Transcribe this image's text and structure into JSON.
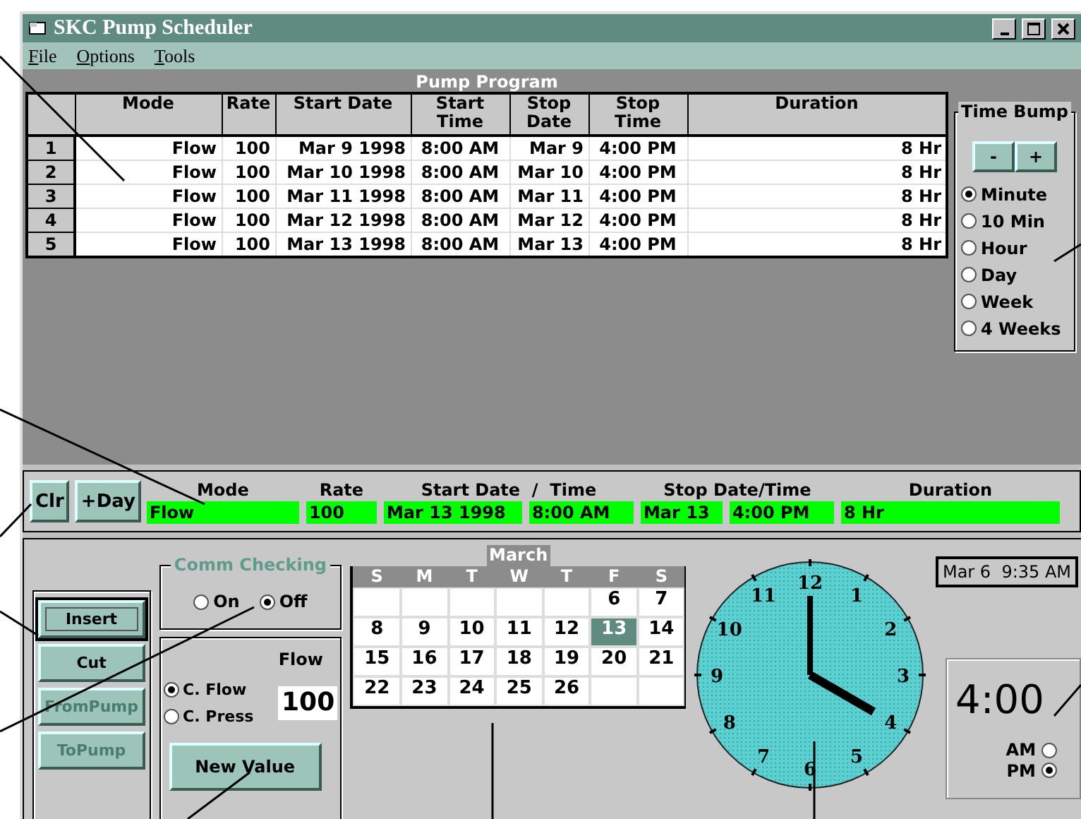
{
  "window": {
    "title": "SKC Pump Scheduler"
  },
  "menu": [
    "File",
    "Options",
    "Tools"
  ],
  "pump_program": {
    "title": "Pump Program",
    "columns": [
      "",
      "Mode",
      "Rate",
      "Start Date",
      "Start Time",
      "Stop Date",
      "Stop Time",
      "Duration"
    ],
    "rows": [
      {
        "cells": [
          "1",
          "Flow",
          "100",
          "Mar 9 1998",
          "8:00 AM",
          "Mar 9",
          "4:00 PM",
          "8 Hr"
        ]
      },
      {
        "cells": [
          "2",
          "Flow",
          "100",
          "Mar 10 1998",
          "8:00 AM",
          "Mar 10",
          "4:00 PM",
          "8 Hr"
        ]
      },
      {
        "cells": [
          "3",
          "Flow",
          "100",
          "Mar 11 1998",
          "8:00 AM",
          "Mar 11",
          "4:00 PM",
          "8 Hr"
        ]
      },
      {
        "cells": [
          "4",
          "Flow",
          "100",
          "Mar 12 1998",
          "8:00 AM",
          "Mar 12",
          "4:00 PM",
          "8 Hr"
        ]
      },
      {
        "cells": [
          "5",
          "Flow",
          "100",
          "Mar 13 1998",
          "8:00 AM",
          "Mar 13",
          "4:00 PM",
          "8 Hr"
        ]
      }
    ]
  },
  "time_bump": {
    "title": "Time Bump",
    "buttons": [
      "-",
      "+"
    ],
    "options": [
      {
        "label": "Minute",
        "selected": true
      },
      {
        "label": "10 Min",
        "selected": false
      },
      {
        "label": "Hour",
        "selected": false
      },
      {
        "label": "Day",
        "selected": false
      },
      {
        "label": "Week",
        "selected": false
      },
      {
        "label": "4 Weeks",
        "selected": false
      }
    ]
  },
  "current_entry": {
    "buttons": [
      "Clr",
      "+Day"
    ],
    "headings": [
      "Mode",
      "Rate",
      "Start Date  /  Time",
      "Stop Date/Time",
      "Duration"
    ],
    "values": [
      "Flow",
      "100",
      "Mar 13 1998",
      "8:00 AM",
      "Mar 13",
      "4:00 PM",
      "8 Hr"
    ]
  },
  "edit_buttons": [
    {
      "label": "Insert",
      "disabled": false,
      "focused": true
    },
    {
      "label": "Cut",
      "disabled": false,
      "focused": false
    },
    {
      "label": "FromPump",
      "disabled": true,
      "focused": false
    },
    {
      "label": "ToPump",
      "disabled": true,
      "focused": false
    }
  ],
  "comm_checking": {
    "title": "Comm Checking",
    "options": [
      {
        "label": "On",
        "selected": false
      },
      {
        "label": "Off",
        "selected": true
      }
    ]
  },
  "control": {
    "options": [
      {
        "label": "C. Flow",
        "selected": true
      },
      {
        "label": "C. Press",
        "selected": false
      }
    ],
    "value_label": "Flow",
    "value": "100",
    "button": "New Value"
  },
  "calendar": {
    "month": "March",
    "weekdays": [
      "S",
      "M",
      "T",
      "W",
      "T",
      "F",
      "S"
    ],
    "weeks": [
      [
        {
          "kind": "blank"
        },
        {
          "kind": "blank"
        },
        {
          "kind": "blank"
        },
        {
          "kind": "blank"
        },
        {
          "kind": "blank"
        },
        {
          "kind": "day",
          "day": "6",
          "selected": false
        },
        {
          "kind": "day",
          "day": "7",
          "selected": false
        }
      ],
      [
        {
          "kind": "day",
          "day": "8",
          "selected": false
        },
        {
          "kind": "day",
          "day": "9",
          "selected": false
        },
        {
          "kind": "day",
          "day": "10",
          "selected": false
        },
        {
          "kind": "day",
          "day": "11",
          "selected": false
        },
        {
          "kind": "day",
          "day": "12",
          "selected": false
        },
        {
          "kind": "day",
          "day": "13",
          "selected": true
        },
        {
          "kind": "day",
          "day": "14",
          "selected": false
        }
      ],
      [
        {
          "kind": "day",
          "day": "15",
          "selected": false
        },
        {
          "kind": "day",
          "day": "16",
          "selected": false
        },
        {
          "kind": "day",
          "day": "17",
          "selected": false
        },
        {
          "kind": "day",
          "day": "18",
          "selected": false
        },
        {
          "kind": "day",
          "day": "19",
          "selected": false
        },
        {
          "kind": "day",
          "day": "20",
          "selected": false
        },
        {
          "kind": "day",
          "day": "21",
          "selected": false
        }
      ],
      [
        {
          "kind": "day",
          "day": "22",
          "selected": false
        },
        {
          "kind": "day",
          "day": "23",
          "selected": false
        },
        {
          "kind": "day",
          "day": "24",
          "selected": false
        },
        {
          "kind": "day",
          "day": "25",
          "selected": false
        },
        {
          "kind": "day",
          "day": "26",
          "selected": false
        },
        {
          "kind": "blank"
        },
        {
          "kind": "blank"
        }
      ]
    ]
  },
  "clock": {
    "numbers": [
      "12",
      "1",
      "2",
      "3",
      "4",
      "5",
      "6",
      "7",
      "8",
      "9",
      "10",
      "11"
    ]
  },
  "now": "Mar 6  9:35 AM",
  "time_entry": {
    "value": "4:00",
    "options": [
      {
        "label": "AM",
        "selected": false
      },
      {
        "label": "PM",
        "selected": true
      }
    ]
  }
}
